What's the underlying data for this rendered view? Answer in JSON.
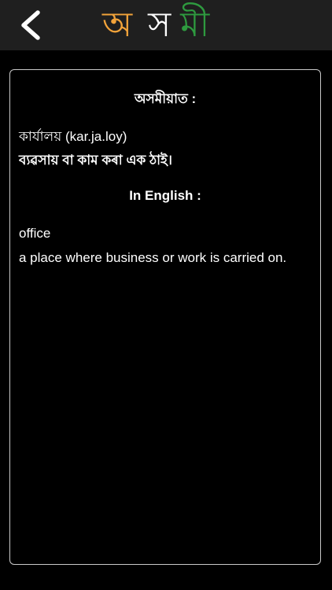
{
  "header": {
    "back_icon": "chevron-left-icon",
    "title_letters": [
      "অ",
      "স",
      "মী"
    ],
    "title_colors": [
      "#f2a33a",
      "#ffffff",
      "#2e9a3f"
    ],
    "background_color": "#1f1f1f"
  },
  "card": {
    "assamese_heading": "অসমীয়াত :",
    "assamese_word": "কাৰ্যালয় (kar.ja.loy)",
    "assamese_meaning": "ব্যৱসায় বা কাম কৰা এক ঠাই।",
    "english_heading": "In English :",
    "english_word": "office",
    "english_meaning": "a place where business or work is carried on.",
    "border_color": "#c9c9c9"
  }
}
